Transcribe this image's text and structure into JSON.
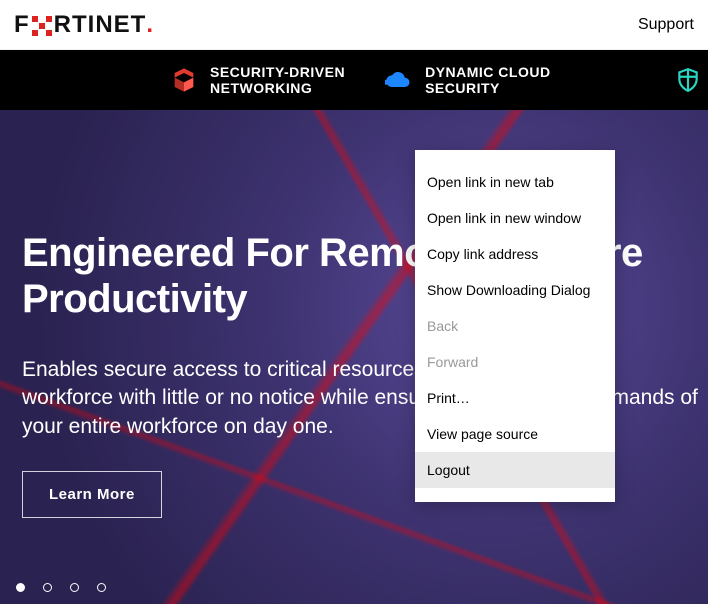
{
  "topbar": {
    "brand_pre": "F",
    "brand_post": "RTINET",
    "support": "Support"
  },
  "nav": {
    "items": [
      {
        "line1": "SECURITY-DRIVEN",
        "line2": "NETWORKING"
      },
      {
        "line1": "DYNAMIC CLOUD",
        "line2": "SECURITY"
      }
    ]
  },
  "hero": {
    "title_l1": "Engineered For Remote & Secure",
    "title_l2": "Productivity",
    "desc": "Enables secure access to critical resources to support a remote workforce with little or no notice while ensuring you meet the demands of your entire workforce on day one.",
    "learn_more": "Learn More"
  },
  "context_menu": {
    "items": [
      {
        "label": "Open link in new tab",
        "disabled": false,
        "hover": false
      },
      {
        "label": "Open link in new window",
        "disabled": false,
        "hover": false
      },
      {
        "label": "Copy link address",
        "disabled": false,
        "hover": false
      },
      {
        "label": "Show Downloading Dialog",
        "disabled": false,
        "hover": false
      },
      {
        "label": "Back",
        "disabled": true,
        "hover": false
      },
      {
        "label": "Forward",
        "disabled": true,
        "hover": false
      },
      {
        "label": "Print…",
        "disabled": false,
        "hover": false
      },
      {
        "label": "View page source",
        "disabled": false,
        "hover": false
      },
      {
        "label": "Logout",
        "disabled": false,
        "hover": true
      }
    ]
  },
  "carousel": {
    "count": 4,
    "active": 0
  }
}
